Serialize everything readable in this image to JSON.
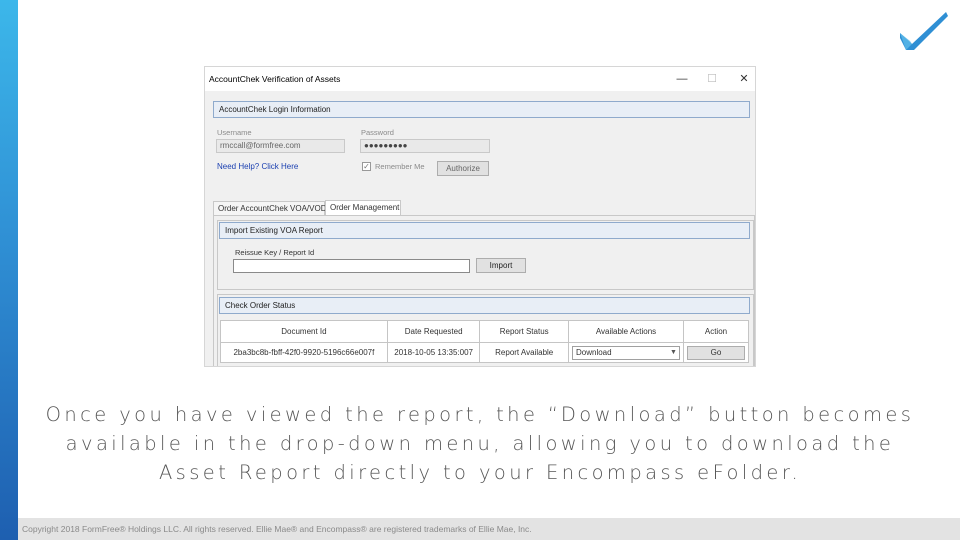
{
  "slide": {
    "caption": "Once you have viewed the report, the “Download” button becomes available in the drop-down menu, allowing you to download the Asset Report directly to your Encompass eFolder.",
    "footer": "Copyright 2018 FormFree® Holdings LLC. All rights reserved. Ellie Mae® and Encompass® are registered trademarks of Ellie Mae, Inc.",
    "colors": {
      "accent_bar_top": "#3cb7ea",
      "accent_bar_bottom": "#1e5fb0",
      "logo": "#2f8fd4"
    },
    "logo_icon": "checkmark-icon"
  },
  "dialog": {
    "title": "AccountChek Verification of Assets",
    "minimize": "—",
    "maximize": "☐",
    "close": "✕",
    "login": {
      "header": "AccountChek Login Information",
      "username_label": "Username",
      "username_value": "rmccall@formfree.com",
      "password_label": "Password",
      "password_value": "●●●●●●●●●",
      "help_link": "Need Help? Click Here",
      "remember_label": "Remember Me",
      "authorize_button": "Authorize"
    },
    "tabs": [
      {
        "label": "Order AccountChek VOA/VOD"
      },
      {
        "label": "Order Management"
      }
    ],
    "import": {
      "header": "Import Existing VOA Report",
      "field_label": "Reissue Key / Report Id",
      "field_value": "",
      "button": "Import"
    },
    "status": {
      "header": "Check Order Status",
      "columns": [
        "Document Id",
        "Date Requested",
        "Report Status",
        "Available Actions",
        "Action"
      ],
      "rows": [
        {
          "document_id": "2ba3bc8b-fbff-42f0-9920-5196c66e007f",
          "date_requested": "2018-10-05 13:35:007",
          "report_status": "Report Available",
          "available_action": "Download",
          "action": "Go"
        }
      ]
    }
  }
}
